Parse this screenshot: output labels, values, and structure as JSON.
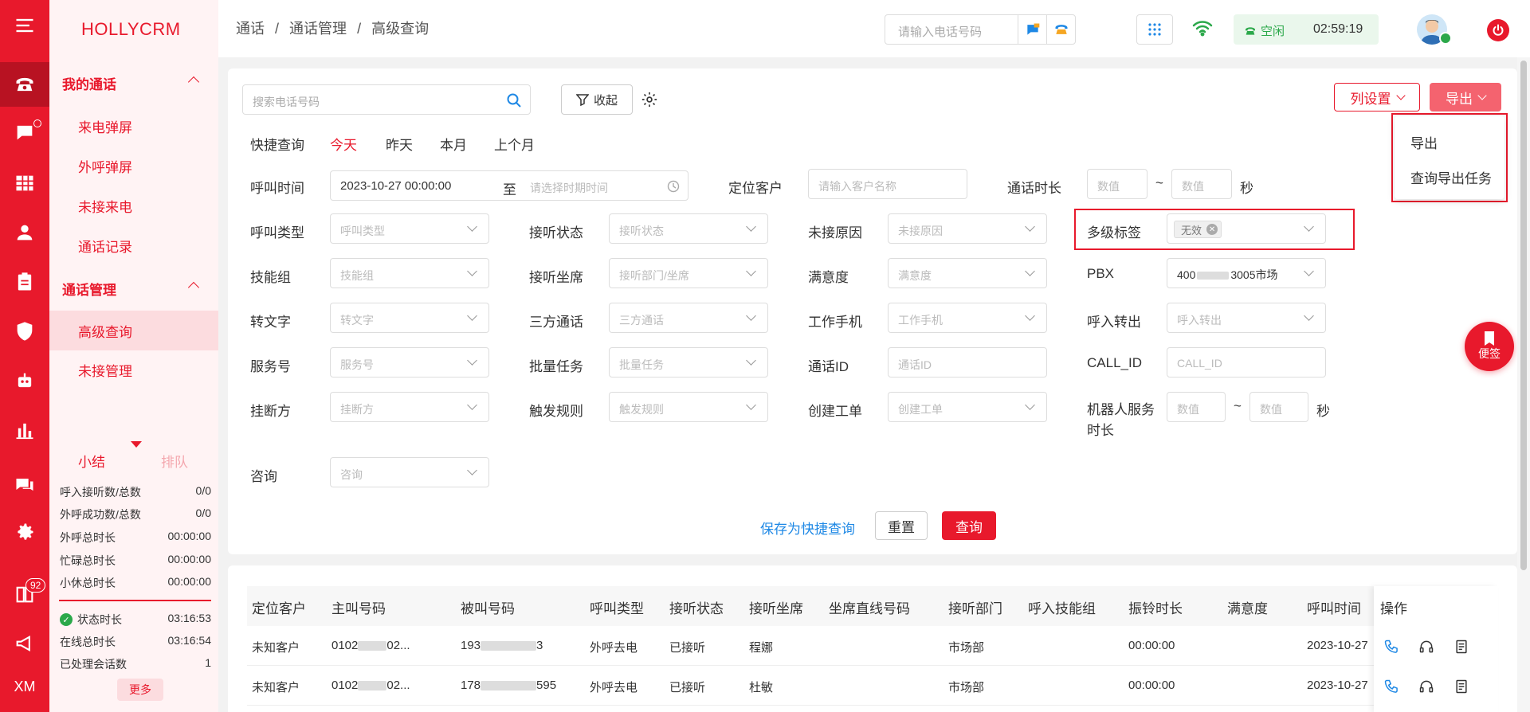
{
  "brand": "HOLLYCRM",
  "breadcrumb": [
    "通话",
    "/",
    "通话管理",
    "/",
    "高级查询"
  ],
  "topbar": {
    "phone_placeholder": "请输入电话号码",
    "status": "空闲",
    "timer": "02:59:19"
  },
  "rail": {
    "badge": "92",
    "xm": "XM"
  },
  "menu": {
    "group1": "我的通话",
    "group1_items": [
      "来电弹屏",
      "外呼弹屏",
      "未接来电",
      "通话记录"
    ],
    "group2": "通话管理",
    "group2_items": [
      "高级查询",
      "未接管理"
    ]
  },
  "summary": {
    "tab_active": "小结",
    "tab_inactive": "排队",
    "rows": [
      {
        "label": "呼入接听数/总数",
        "value": "0/0"
      },
      {
        "label": "外呼成功数/总数",
        "value": "0/0"
      },
      {
        "label": "外呼总时长",
        "value": "00:00:00"
      },
      {
        "label": "忙碌总时长",
        "value": "00:00:00"
      },
      {
        "label": "小休总时长",
        "value": "00:00:00"
      }
    ],
    "rows2": [
      {
        "label": "状态时长",
        "value": "03:16:53"
      },
      {
        "label": "在线总时长",
        "value": "03:16:54"
      },
      {
        "label": "已处理会话数",
        "value": "1"
      }
    ],
    "more": "更多"
  },
  "filters": {
    "search_placeholder": "搜索电话号码",
    "collapse": "收起",
    "col_settings": "列设置",
    "export": "导出",
    "export_menu": [
      "导出",
      "查询导出任务"
    ],
    "quick_label": "快捷查询",
    "quick_options": [
      "今天",
      "昨天",
      "本月",
      "上个月"
    ],
    "call_time_label": "呼叫时间",
    "call_time_start": "2023-10-27 00:00:00",
    "call_time_to": "至",
    "call_time_end_ph": "请选择时期时间",
    "locate_label": "定位客户",
    "locate_ph": "请输入客户名称",
    "duration_label": "通话时长",
    "num_ph": "数值",
    "tilde": "~",
    "sec": "秒",
    "rows": [
      [
        "呼叫类型",
        "呼叫类型",
        "接听状态",
        "接听状态",
        "未接原因",
        "未接原因"
      ],
      [
        "技能组",
        "技能组",
        "接听坐席",
        "接听部门/坐席",
        "满意度",
        "满意度"
      ],
      [
        "转文字",
        "转文字",
        "三方通话",
        "三方通话",
        "工作手机",
        "工作手机"
      ],
      [
        "服务号",
        "服务号",
        "批量任务",
        "批量任务",
        "通话ID",
        "通话ID"
      ],
      [
        "挂断方",
        "挂断方",
        "触发规则",
        "触发规则",
        "创建工单",
        "创建工单"
      ]
    ],
    "tag_label": "多级标签",
    "tag_value": "无效",
    "pbx_label": "PBX",
    "pbx_value_a": "400",
    "pbx_value_b": "3005市场",
    "transfer_label": "呼入转出",
    "transfer_ph": "呼入转出",
    "callid_label": "CALL_ID",
    "callid_ph": "CALL_ID",
    "robot_label_1": "机器人服务",
    "robot_label_2": "时长",
    "consult_label": "咨询",
    "consult_ph": "咨询",
    "save_quick": "保存为快捷查询",
    "reset": "重置",
    "query": "查询"
  },
  "note_button": "便签",
  "table": {
    "headers": [
      "定位客户",
      "主叫号码",
      "被叫号码",
      "呼叫类型",
      "接听状态",
      "接听坐席",
      "坐席直线号码",
      "接听部门",
      "呼入技能组",
      "振铃时长",
      "满意度",
      "呼叫时间",
      "操作"
    ],
    "rows": [
      {
        "customer": "未知客户",
        "caller": "0102",
        "caller_tail": "02...",
        "callee": "193",
        "callee_tail": "3",
        "type": "外呼去电",
        "status": "已接听",
        "agent": "程娜",
        "dept": "市场部",
        "ring": "00:00:00",
        "time": "2023-10-27"
      },
      {
        "customer": "未知客户",
        "caller": "0102",
        "caller_tail": "02...",
        "callee": "178",
        "callee_tail": "595",
        "type": "外呼去电",
        "status": "已接听",
        "agent": "杜敏",
        "dept": "市场部",
        "ring": "00:00:00",
        "time": "2023-10-27"
      }
    ]
  },
  "colors": {
    "primary": "#e8192c",
    "link": "#1e88e5",
    "ok": "#2ba84a"
  }
}
